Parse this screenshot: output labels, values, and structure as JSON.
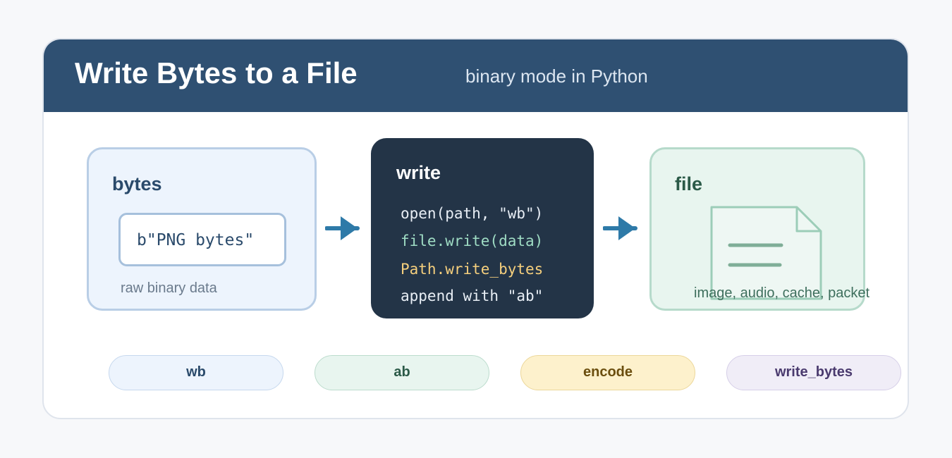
{
  "header": {
    "title": "Write Bytes to a File",
    "subtitle": "binary mode in Python"
  },
  "bytes_panel": {
    "title": "bytes",
    "literal": "b\"PNG bytes\"",
    "caption": "raw binary data"
  },
  "write_panel": {
    "title": "write",
    "lines": [
      "open(path, \"wb\")",
      "file.write(data)",
      "Path.write_bytes",
      "append with \"ab\""
    ]
  },
  "file_panel": {
    "title": "file",
    "caption": "image, audio, cache, packet",
    "icon": "document-icon"
  },
  "tags": [
    "wb",
    "ab",
    "encode",
    "write_bytes"
  ],
  "colors": {
    "header": "#2f5072",
    "arrow": "#2e7aa8",
    "code_plain": "#e8eef5",
    "code_green": "#9fdcc4",
    "code_yellow": "#f5cf7d"
  }
}
